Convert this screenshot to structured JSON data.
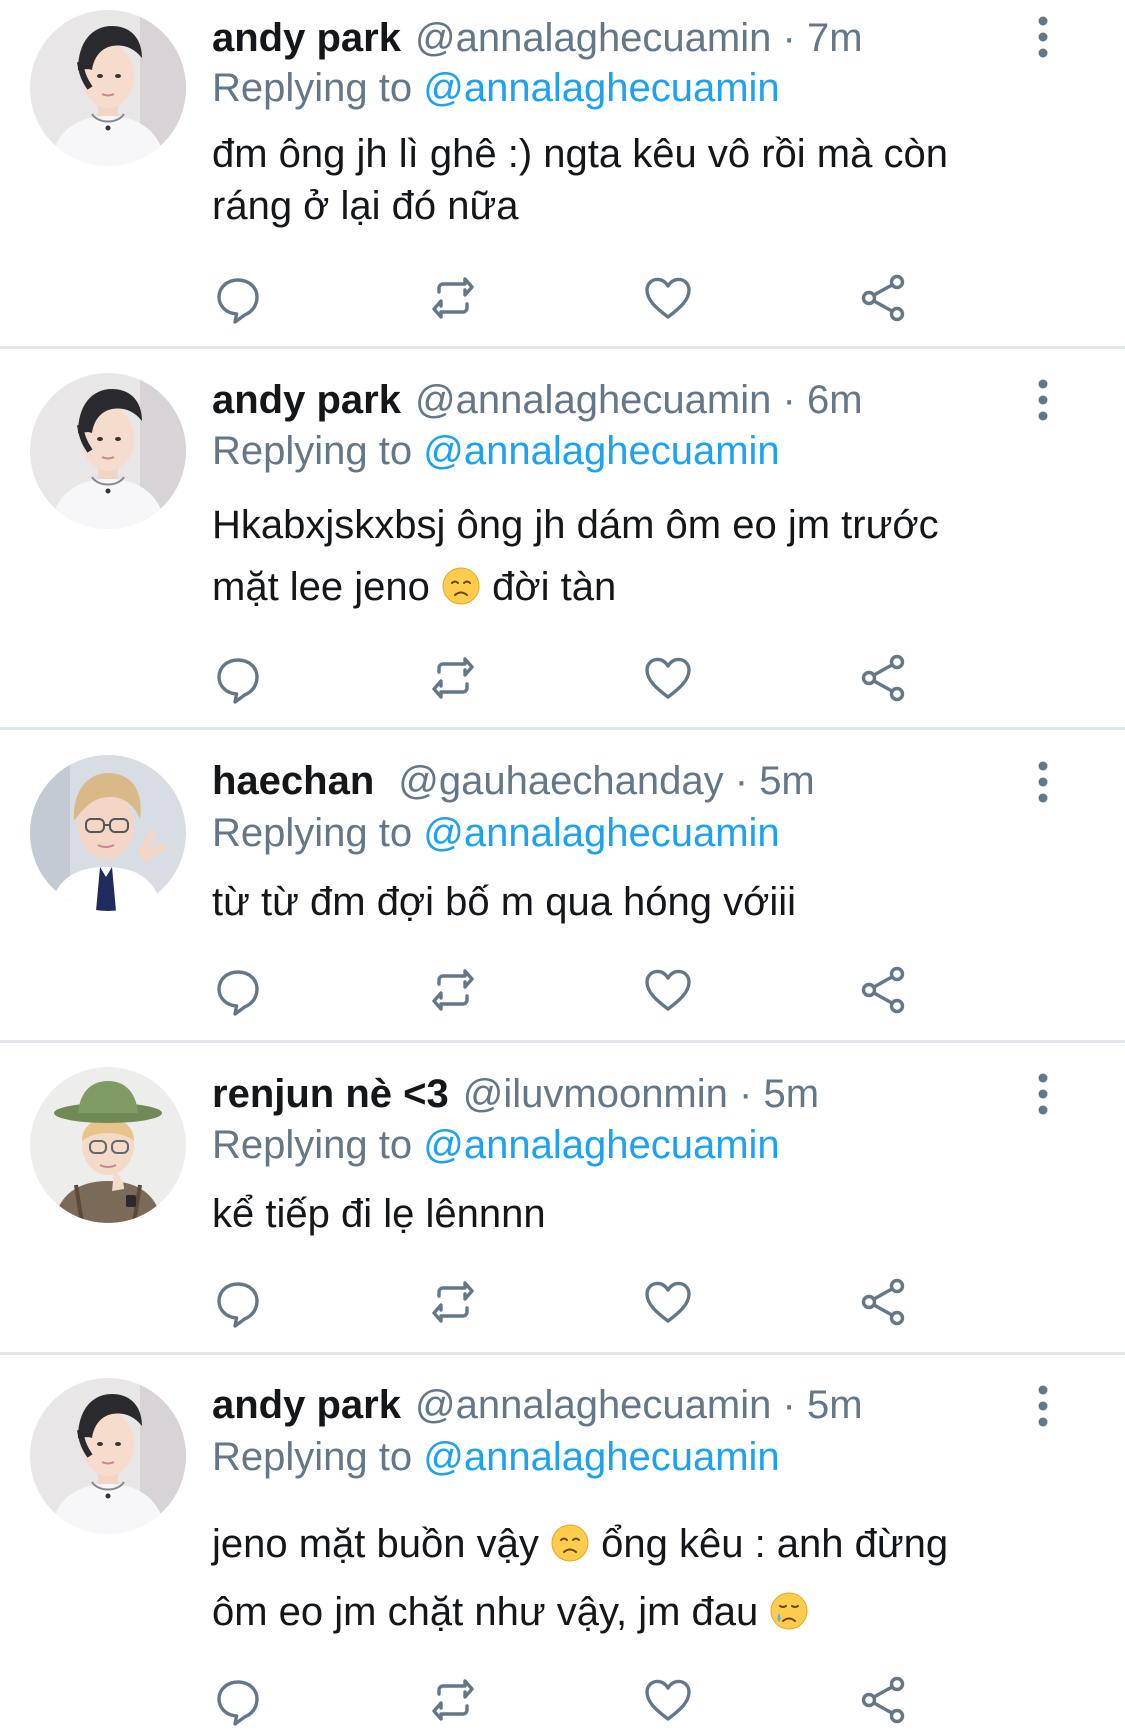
{
  "tweets": [
    {
      "name": "andy park",
      "handle": "@annalaghecuamin",
      "sep": "·",
      "time": "7m",
      "replying_label": "Replying to",
      "replying_handle": "@annalaghecuamin",
      "text_lines": [
        "đm ông jh lì ghê :) ngta kêu vô rồi mà còn",
        "ráng ở lại đó nữa"
      ],
      "avatar": "avatar-andy"
    },
    {
      "name": "andy park",
      "handle": "@annalaghecuamin",
      "sep": "·",
      "time": "6m",
      "replying_label": "Replying to",
      "replying_handle": "@annalaghecuamin",
      "text_line1": "Hkabxjskxbsj ông jh dám ôm eo jm trước",
      "text_line2_a": "mặt lee jeno ",
      "text_line2_b": " đời tàn",
      "emoji": "disappointed-face-emoji",
      "avatar": "avatar-andy"
    },
    {
      "name": "haechan",
      "handle": "@gauhaechanday",
      "sep": "·",
      "time": "5m",
      "replying_label": "Replying to",
      "replying_handle": "@annalaghecuamin",
      "text": "từ từ đm đợi bố m qua hóng vớiii",
      "avatar": "avatar-haechan"
    },
    {
      "name": "renjun nè <3",
      "handle": "@iluvmoonmin",
      "sep": "·",
      "time": "5m",
      "replying_label": "Replying to",
      "replying_handle": "@annalaghecuamin",
      "text": "kể tiếp đi lẹ lênnnn",
      "avatar": "avatar-renjun"
    },
    {
      "name": "andy park",
      "handle": "@annalaghecuamin",
      "sep": "·",
      "time": "5m",
      "replying_label": "Replying to",
      "replying_handle": "@annalaghecuamin",
      "text_line1_a": "jeno mặt buồn vậy ",
      "text_line1_b": " ổng kêu : anh đừng",
      "text_line2_a": "ôm eo jm chặt như vậy, jm đau ",
      "emoji1": "disappointed-face-emoji",
      "emoji2": "crying-face-emoji",
      "avatar": "avatar-andy"
    }
  ],
  "icons": {
    "reply": "speech-bubble-icon",
    "retweet": "retweet-icon",
    "like": "heart-icon",
    "share": "share-icon",
    "more": "vertical-dots-icon"
  },
  "colors": {
    "link": "#1da1f2",
    "secondary_text": "#657786",
    "primary_text": "#14171a",
    "divider": "#e1e8ed"
  }
}
